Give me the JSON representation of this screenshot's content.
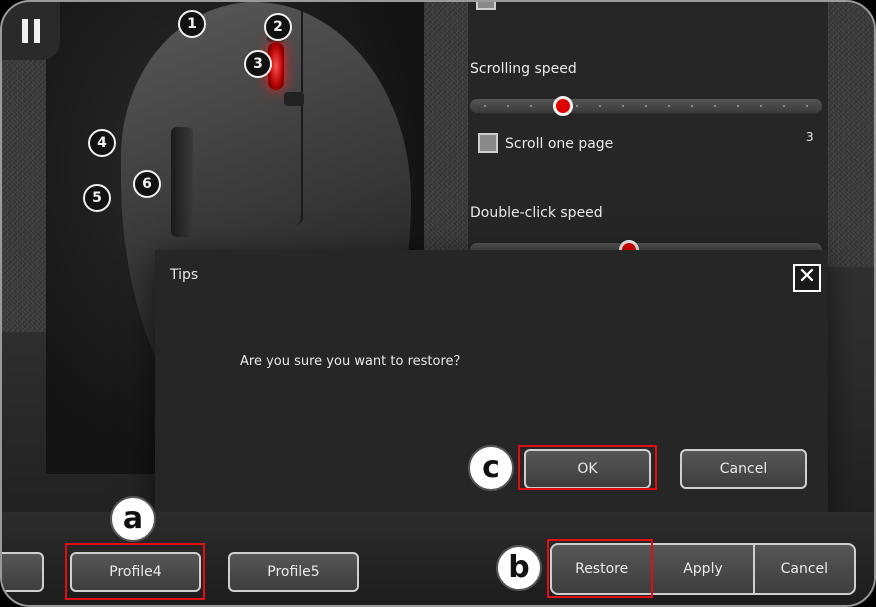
{
  "settings": {
    "scrolling_speed_label": "Scrolling speed",
    "scrolling_speed_value": 0.25,
    "scroll_one_page_label": "Scroll one page",
    "scroll_one_page_checked": false,
    "scroll_lines_value": "3",
    "double_click_label": "Double-click speed",
    "double_click_value": 0.45
  },
  "mouse_callouts": [
    "1",
    "2",
    "3",
    "4",
    "5",
    "6"
  ],
  "dialog": {
    "title": "Tips",
    "close_glyph": "✕",
    "message": "Are you sure you want to restore？",
    "ok_label": "OK",
    "cancel_label": "Cancel"
  },
  "profiles": {
    "items": [
      "Profile4",
      "Profile5"
    ]
  },
  "actions": {
    "restore_label": "Restore",
    "apply_label": "Apply",
    "cancel_label": "Cancel"
  },
  "annotations": {
    "a": "a",
    "b": "b",
    "c": "c"
  },
  "colors": {
    "accent_red": "#e10000",
    "highlight_red": "#e01010"
  }
}
